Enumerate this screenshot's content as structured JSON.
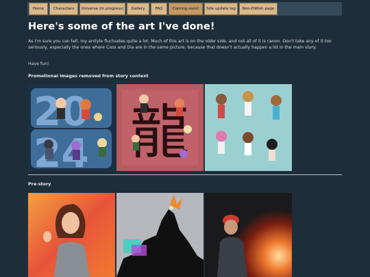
{
  "nav": {
    "items": [
      {
        "label": "Home"
      },
      {
        "label": "Characters"
      },
      {
        "label": "Universe (in progress)"
      },
      {
        "label": "Gallery"
      },
      {
        "label": "FAQ"
      },
      {
        "label": "Coming soon!"
      },
      {
        "label": "Site update log"
      },
      {
        "label": "Non-DWish page"
      }
    ],
    "active_index": 5
  },
  "main": {
    "title": "Here's some of the art I've done!",
    "intro": "As I'm sure you can tell, my arstyle fluctuates quite a lot. Much of this art is on the older side, and not all of it is canon. Don't take any of it too seriously, especially the ones where Cass and Dia are in the same picture, because that doesn't actually happen a lot in the main story.",
    "fun": "Have fun!",
    "sections": [
      {
        "heading": "Promotional images removed from story context"
      },
      {
        "heading": "Pre-story"
      }
    ]
  },
  "colors": {
    "background": "#1e2d3a",
    "nav_bar": "#34495a",
    "nav_button": "#d9b88a",
    "nav_button_active": "#c49a62",
    "text": "#dcdcdc"
  }
}
